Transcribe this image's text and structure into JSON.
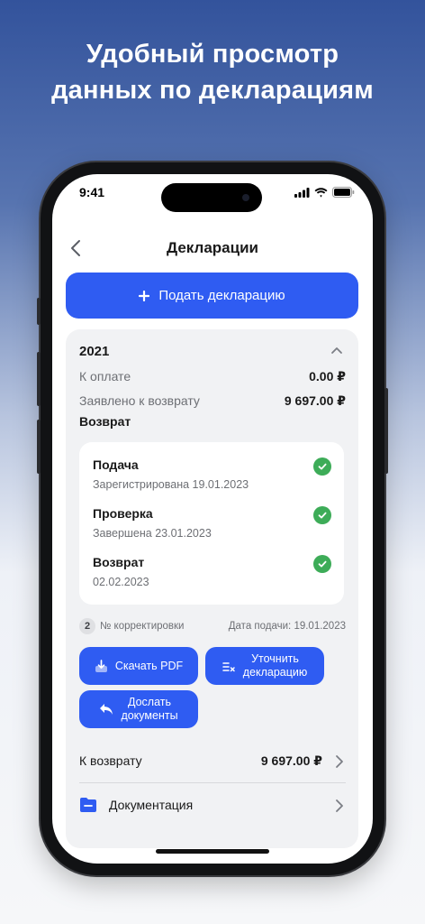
{
  "headline": {
    "line1": "Удобный просмотр",
    "line2": "данных по декларациям"
  },
  "status_bar": {
    "time": "9:41",
    "icons": [
      "signal-icon",
      "wifi-icon",
      "battery-icon"
    ]
  },
  "nav": {
    "back_icon": "chevron-left-icon",
    "title": "Декларации"
  },
  "primary_button": {
    "icon": "plus-icon",
    "label": "Подать декларацию"
  },
  "declaration": {
    "year": "2021",
    "collapse_icon": "chevron-up-icon",
    "to_pay_label": "К оплате",
    "to_pay_value": "0.00 ₽",
    "claimed_label": "Заявлено к возврату",
    "claimed_value": "9 697.00 ₽",
    "section_label": "Возврат",
    "steps": [
      {
        "title": "Подача",
        "subtitle": "Зарегистрирована 19.01.2023",
        "status_icon": "check-circle-icon"
      },
      {
        "title": "Проверка",
        "subtitle": "Завершена 23.01.2023",
        "status_icon": "check-circle-icon"
      },
      {
        "title": "Возврат",
        "subtitle": "02.02.2023",
        "status_icon": "check-circle-icon"
      }
    ],
    "correction_number": "2",
    "correction_label": "№ корректировки",
    "filing_date": "Дата подачи: 19.01.2023",
    "actions": {
      "download_pdf": "Скачать PDF",
      "clarify_line1": "Уточнить",
      "clarify_line2": "декларацию",
      "send_docs_line1": "Дослать",
      "send_docs_line2": "документы"
    },
    "refund_label": "К возврату",
    "refund_value": "9 697.00 ₽",
    "documentation_label": "Документация"
  },
  "colors": {
    "accent": "#2f5cf2",
    "success": "#3dac58",
    "card_bg": "#f1f2f4"
  }
}
